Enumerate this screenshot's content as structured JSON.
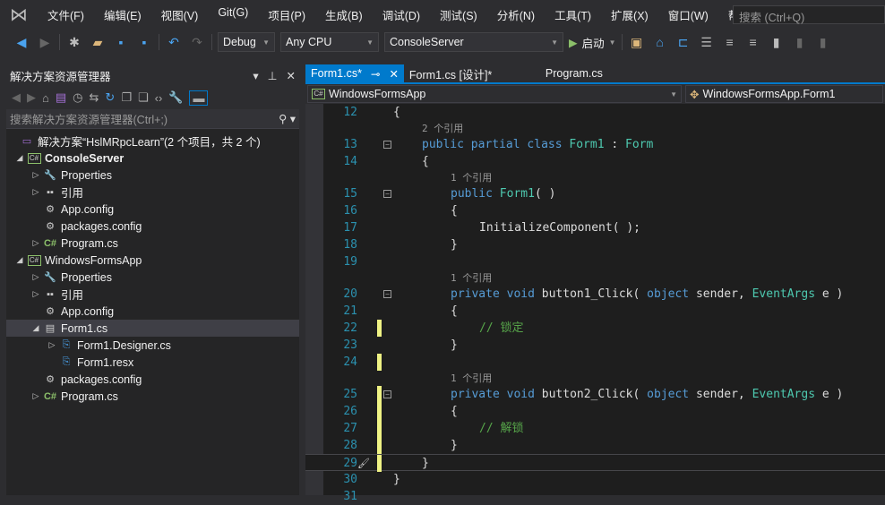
{
  "menu": [
    "文件(F)",
    "编辑(E)",
    "视图(V)",
    "Git(G)",
    "项目(P)",
    "生成(B)",
    "调试(D)",
    "测试(S)",
    "分析(N)",
    "工具(T)",
    "扩展(X)",
    "窗口(W)",
    "帮助(H)"
  ],
  "search_placeholder": "搜索 (Ctrl+Q)",
  "toolbar": {
    "config": "Debug",
    "platform": "Any CPU",
    "startup": "ConsoleServer",
    "start": "启动"
  },
  "solution_explorer": {
    "title": "解决方案资源管理器",
    "search_placeholder": "搜索解决方案资源管理器(Ctrl+;)",
    "items": [
      {
        "label": "解决方案“HslMRpcLearn”(2 个项目，共 2 个)",
        "level": 0,
        "exp": "",
        "icon": "solution"
      },
      {
        "label": "ConsoleServer",
        "level": 0,
        "exp": "open",
        "icon": "csproj",
        "bold": true
      },
      {
        "label": "Properties",
        "level": 1,
        "exp": "closed",
        "icon": "wrench"
      },
      {
        "label": "引用",
        "level": 1,
        "exp": "closed",
        "icon": "references"
      },
      {
        "label": "App.config",
        "level": 1,
        "exp": "",
        "icon": "config"
      },
      {
        "label": "packages.config",
        "level": 1,
        "exp": "",
        "icon": "config"
      },
      {
        "label": "Program.cs",
        "level": 1,
        "exp": "closed",
        "icon": "cs"
      },
      {
        "label": "WindowsFormsApp",
        "level": 0,
        "exp": "open",
        "icon": "csproj"
      },
      {
        "label": "Properties",
        "level": 1,
        "exp": "closed",
        "icon": "wrench"
      },
      {
        "label": "引用",
        "level": 1,
        "exp": "closed",
        "icon": "references"
      },
      {
        "label": "App.config",
        "level": 1,
        "exp": "",
        "icon": "config"
      },
      {
        "label": "Form1.cs",
        "level": 1,
        "exp": "open",
        "icon": "form",
        "selected": true
      },
      {
        "label": "Form1.Designer.cs",
        "level": 2,
        "exp": "closed",
        "icon": "file"
      },
      {
        "label": "Form1.resx",
        "level": 2,
        "exp": "",
        "icon": "file"
      },
      {
        "label": "packages.config",
        "level": 1,
        "exp": "",
        "icon": "config"
      },
      {
        "label": "Program.cs",
        "level": 1,
        "exp": "closed",
        "icon": "cs"
      }
    ]
  },
  "tabs": [
    {
      "label": "Form1.cs*",
      "active": true
    },
    {
      "label": "Form1.cs [设计]*"
    },
    {
      "label": "Program.cs"
    }
  ],
  "nav": {
    "project": "WindowsFormsApp",
    "class": "WindowsFormsApp.Form1"
  },
  "code": [
    {
      "n": "12",
      "i": 0,
      "t": [
        [
          "{",
          "pl"
        ]
      ]
    },
    {
      "lens": "2 个引用",
      "i": 1
    },
    {
      "n": "13",
      "i": 1,
      "f": 1,
      "t": [
        [
          "public ",
          "kw"
        ],
        [
          "partial ",
          "kw"
        ],
        [
          "class ",
          "kw"
        ],
        [
          "Form1",
          "ty"
        ],
        [
          " : ",
          "pl"
        ],
        [
          "Form",
          "ty"
        ]
      ]
    },
    {
      "n": "14",
      "i": 1,
      "t": [
        [
          "{",
          "pl"
        ]
      ]
    },
    {
      "lens": "1 个引用",
      "i": 2
    },
    {
      "n": "15",
      "i": 2,
      "f": 1,
      "t": [
        [
          "public ",
          "kw"
        ],
        [
          "Form1",
          "ty"
        ],
        [
          "( )",
          "pl"
        ]
      ]
    },
    {
      "n": "16",
      "i": 2,
      "t": [
        [
          "{",
          "pl"
        ]
      ]
    },
    {
      "n": "17",
      "i": 3,
      "t": [
        [
          "InitializeComponent( );",
          "pl"
        ]
      ]
    },
    {
      "n": "18",
      "i": 2,
      "t": [
        [
          "}",
          "pl"
        ]
      ]
    },
    {
      "n": "19",
      "i": 0,
      "t": []
    },
    {
      "lens": "1 个引用",
      "i": 2
    },
    {
      "n": "20",
      "i": 2,
      "f": 1,
      "t": [
        [
          "private ",
          "kw"
        ],
        [
          "void ",
          "kw"
        ],
        [
          "button1_Click( ",
          "pl"
        ],
        [
          "object ",
          "kw"
        ],
        [
          "sender, ",
          "pl"
        ],
        [
          "EventArgs ",
          "ty"
        ],
        [
          "e )",
          "pl"
        ]
      ]
    },
    {
      "n": "21",
      "i": 2,
      "t": [
        [
          "{",
          "pl"
        ]
      ]
    },
    {
      "n": "22",
      "i": 3,
      "c": 1,
      "t": [
        [
          "// 锁定",
          "cm"
        ]
      ]
    },
    {
      "n": "23",
      "i": 2,
      "t": [
        [
          "}",
          "pl"
        ]
      ]
    },
    {
      "n": "24",
      "i": 0,
      "c": 1,
      "t": []
    },
    {
      "lens": "1 个引用",
      "i": 2
    },
    {
      "n": "25",
      "i": 2,
      "f": 1,
      "c": 1,
      "t": [
        [
          "private ",
          "kw"
        ],
        [
          "void ",
          "kw"
        ],
        [
          "button2_Click( ",
          "pl"
        ],
        [
          "object ",
          "kw"
        ],
        [
          "sender, ",
          "pl"
        ],
        [
          "EventArgs ",
          "ty"
        ],
        [
          "e )",
          "pl"
        ]
      ]
    },
    {
      "n": "26",
      "i": 2,
      "c": 1,
      "t": [
        [
          "{",
          "pl"
        ]
      ]
    },
    {
      "n": "27",
      "i": 3,
      "c": 1,
      "t": [
        [
          "// 解锁",
          "cm"
        ]
      ]
    },
    {
      "n": "28",
      "i": 2,
      "c": 1,
      "t": [
        [
          "}",
          "pl"
        ]
      ]
    },
    {
      "n": "29",
      "i": 1,
      "c": 1,
      "t": [
        [
          "}",
          "pl"
        ]
      ]
    },
    {
      "n": "30",
      "i": 0,
      "t": [
        [
          "}",
          "pl"
        ]
      ]
    },
    {
      "n": "31",
      "i": 0,
      "t": []
    }
  ]
}
